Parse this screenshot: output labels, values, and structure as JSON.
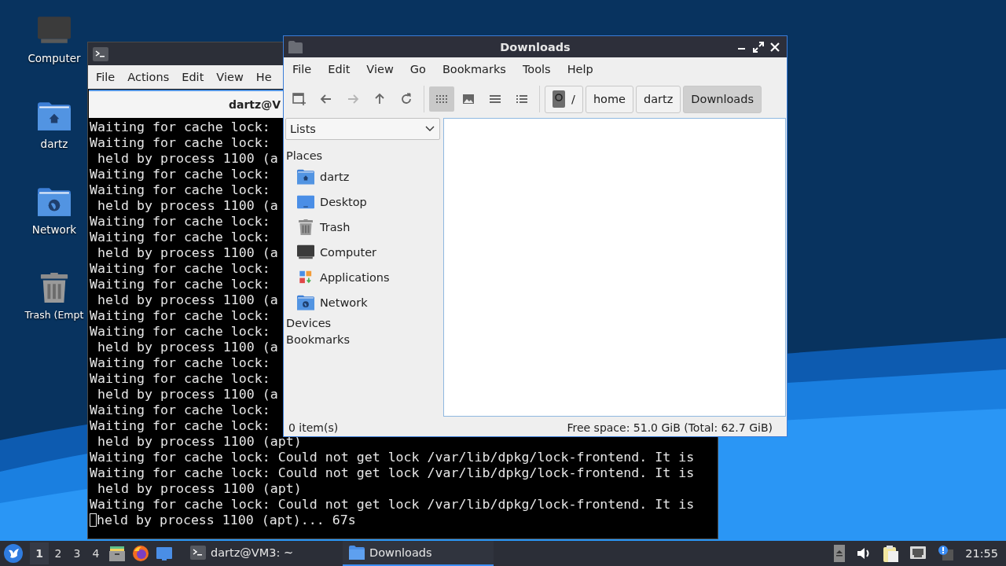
{
  "desktop": {
    "icons": [
      {
        "kind": "computer",
        "label": "Computer"
      },
      {
        "kind": "home",
        "label": "dartz"
      },
      {
        "kind": "network",
        "label": "Network"
      },
      {
        "kind": "trash",
        "label": "Trash (Empt"
      }
    ]
  },
  "terminal": {
    "title": "dartz@V",
    "menu": [
      "File",
      "Actions",
      "Edit",
      "View",
      "He"
    ],
    "cursor": true,
    "lines": [
      "Waiting for cache lock:",
      "Waiting for cache lock:",
      " held by process 1100 (a",
      "Waiting for cache lock:",
      "Waiting for cache lock:",
      " held by process 1100 (a",
      "Waiting for cache lock:",
      "Waiting for cache lock:",
      " held by process 1100 (a",
      "Waiting for cache lock:",
      "Waiting for cache lock:",
      " held by process 1100 (a",
      "Waiting for cache lock:",
      "Waiting for cache lock:",
      " held by process 1100 (a",
      "Waiting for cache lock:",
      "Waiting for cache lock:",
      " held by process 1100 (a",
      "Waiting for cache lock:",
      "Waiting for cache lock:",
      " held by process 1100 (apt)",
      "Waiting for cache lock: Could not get lock /var/lib/dpkg/lock-frontend. It is",
      "Waiting for cache lock: Could not get lock /var/lib/dpkg/lock-frontend. It is",
      " held by process 1100 (apt)",
      "Waiting for cache lock: Could not get lock /var/lib/dpkg/lock-frontend. It is",
      "held by process 1100 (apt)... 67s"
    ]
  },
  "file_manager": {
    "title": "Downloads",
    "menu": [
      "File",
      "Edit",
      "View",
      "Go",
      "Bookmarks",
      "Tools",
      "Help"
    ],
    "toolbar": [
      {
        "kind": "new-tab",
        "disabled": false
      },
      {
        "kind": "back",
        "disabled": false
      },
      {
        "kind": "forward",
        "disabled": true
      },
      {
        "kind": "up",
        "disabled": false
      },
      {
        "kind": "reload",
        "disabled": false
      }
    ],
    "view_modes": [
      {
        "kind": "icons",
        "selected": true
      },
      {
        "kind": "thumbnails",
        "selected": false
      },
      {
        "kind": "compact",
        "selected": false
      },
      {
        "kind": "detailed",
        "selected": false
      }
    ],
    "path": [
      {
        "kind": "root",
        "label": "/",
        "selected": false
      },
      {
        "kind": "dir",
        "label": "home",
        "selected": false
      },
      {
        "kind": "dir",
        "label": "dartz",
        "selected": false
      },
      {
        "kind": "dir",
        "label": "Downloads",
        "selected": true
      }
    ],
    "sidebar": {
      "selector": "Lists",
      "sections": [
        {
          "title": "Places",
          "items": [
            {
              "kind": "home",
              "label": "dartz"
            },
            {
              "kind": "desktop",
              "label": "Desktop"
            },
            {
              "kind": "trash",
              "label": "Trash"
            },
            {
              "kind": "computer",
              "label": "Computer"
            },
            {
              "kind": "applications",
              "label": "Applications"
            },
            {
              "kind": "network",
              "label": "Network"
            }
          ]
        },
        {
          "title": "Devices"
        },
        {
          "title": "Bookmarks"
        }
      ]
    },
    "status": {
      "items": "0 item(s)",
      "free_space": "Free space: 51.0 GiB (Total: 62.7 GiB)"
    }
  },
  "taskbar": {
    "workspaces": [
      {
        "label": "1",
        "selected": true
      },
      {
        "label": "2",
        "selected": false
      },
      {
        "label": "3",
        "selected": false
      },
      {
        "label": "4",
        "selected": false
      }
    ],
    "launchers": [
      {
        "kind": "file-cabinet"
      },
      {
        "kind": "firefox"
      },
      {
        "kind": "desktop"
      }
    ],
    "tasks": [
      {
        "kind": "terminal",
        "label": "dartz@VM3: ~",
        "selected": false
      },
      {
        "kind": "folder",
        "label": "Downloads",
        "selected": true
      }
    ],
    "tray": [
      {
        "kind": "eject"
      },
      {
        "kind": "volume"
      },
      {
        "kind": "clipboard"
      },
      {
        "kind": "network"
      },
      {
        "kind": "notification"
      }
    ],
    "clock": "21:55"
  }
}
